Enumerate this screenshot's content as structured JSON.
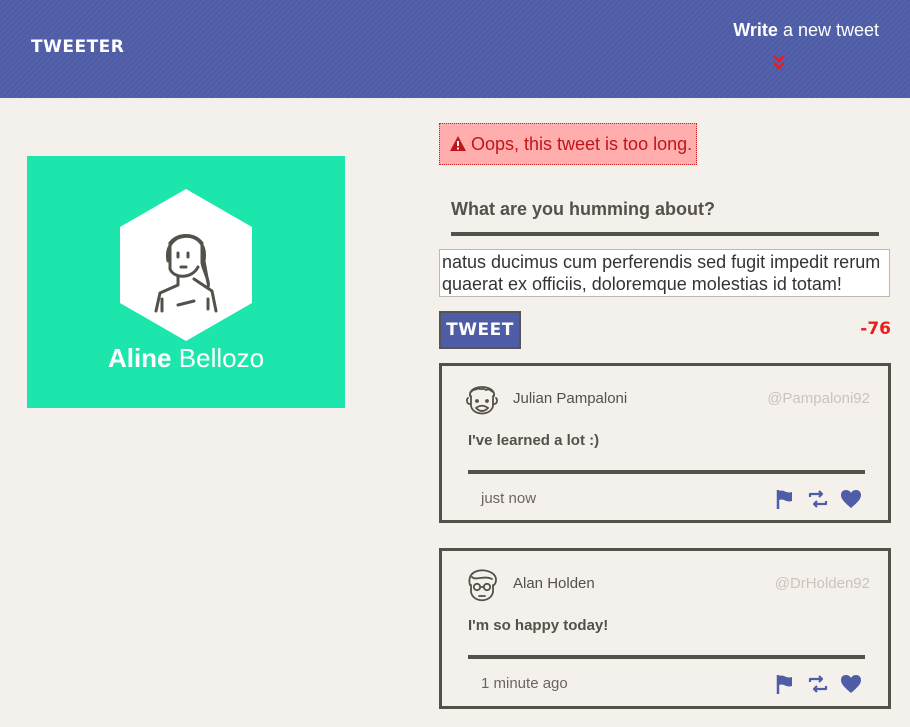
{
  "header": {
    "brand": "TWEETER",
    "compose_strong": "Write",
    "compose_rest": " a new tweet"
  },
  "profile": {
    "first_name": "Aline",
    "last_name": "Bellozo"
  },
  "alert": {
    "message": "Oops, this tweet is too long."
  },
  "composer": {
    "label": "What are you humming about?",
    "value": "natus ducimus cum perferendis sed fugit impedit rerum quaerat ex officiis, doloremque molestias id totam!",
    "button": "TWEET",
    "remaining": "-76"
  },
  "tweets": [
    {
      "name": "Julian Pampaloni",
      "handle": "@Pampaloni92",
      "text": "I've learned a lot :)",
      "time": "just now"
    },
    {
      "name": "Alan Holden",
      "handle": "@DrHolden92",
      "text": "I'm so happy today!",
      "time": "1 minute ago"
    }
  ],
  "colors": {
    "header_bg": "#4e5da6",
    "profile_bg": "#1de6ad",
    "error_bg": "#ffadad",
    "error_text": "#c0161a",
    "counter": "#ee1b1b",
    "ink": "#545149"
  },
  "icons": {
    "toggle": "double-chevron-down-icon",
    "alert": "warning-icon",
    "flag": "flag-icon",
    "retweet": "retweet-icon",
    "like": "heart-icon"
  }
}
